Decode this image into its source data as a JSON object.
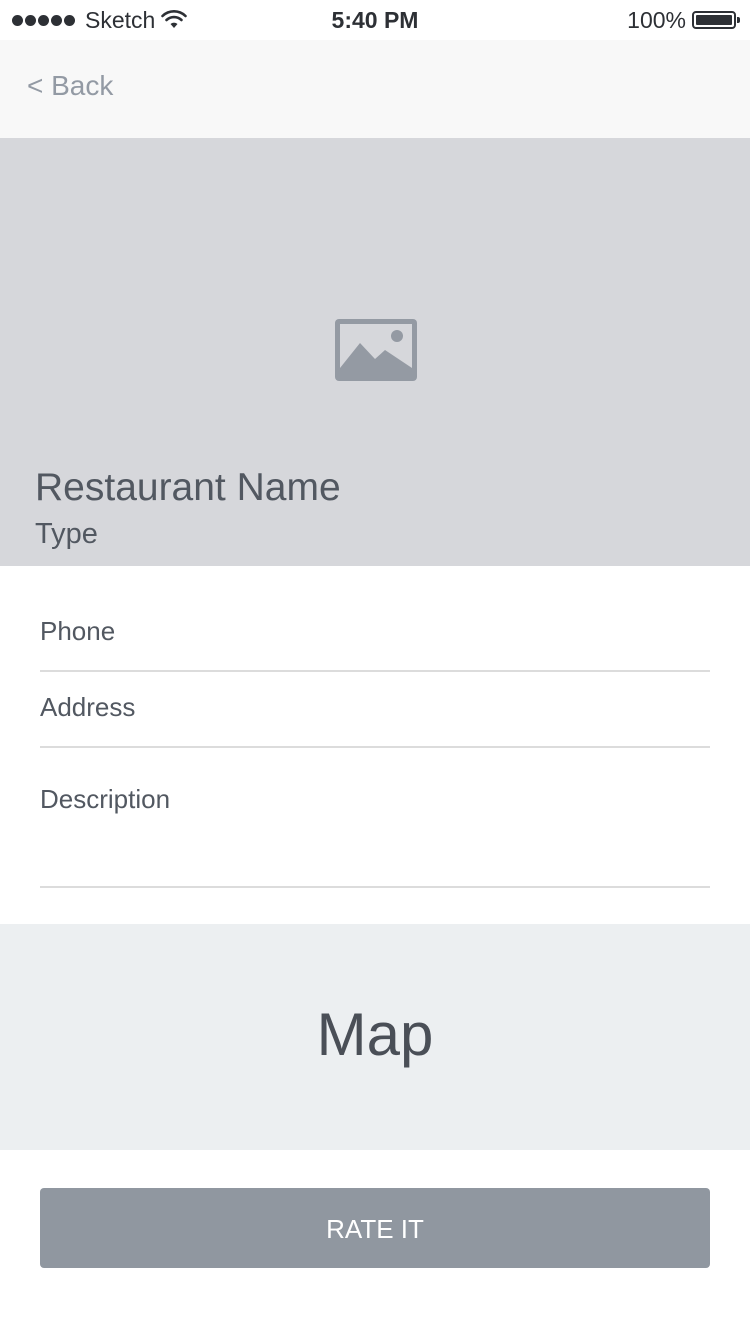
{
  "status_bar": {
    "carrier": "Sketch",
    "time": "5:40 PM",
    "battery": "100%",
    "signal_icon": "signal-dots-icon",
    "wifi_icon": "wifi-icon",
    "battery_icon": "battery-icon"
  },
  "nav": {
    "back_label": "< Back"
  },
  "hero": {
    "image_icon": "image-placeholder-icon",
    "name": "Restaurant Name",
    "type": "Type"
  },
  "fields": {
    "phone": "Phone",
    "address": "Address",
    "description": "Description"
  },
  "map": {
    "label": "Map"
  },
  "actions": {
    "rate_label": "RATE IT"
  },
  "colors": {
    "hero_bg": "#d6d7db",
    "map_bg": "#eceff1",
    "button_bg": "#9097a0",
    "text_primary": "#525861",
    "back_text": "#939aa4"
  }
}
